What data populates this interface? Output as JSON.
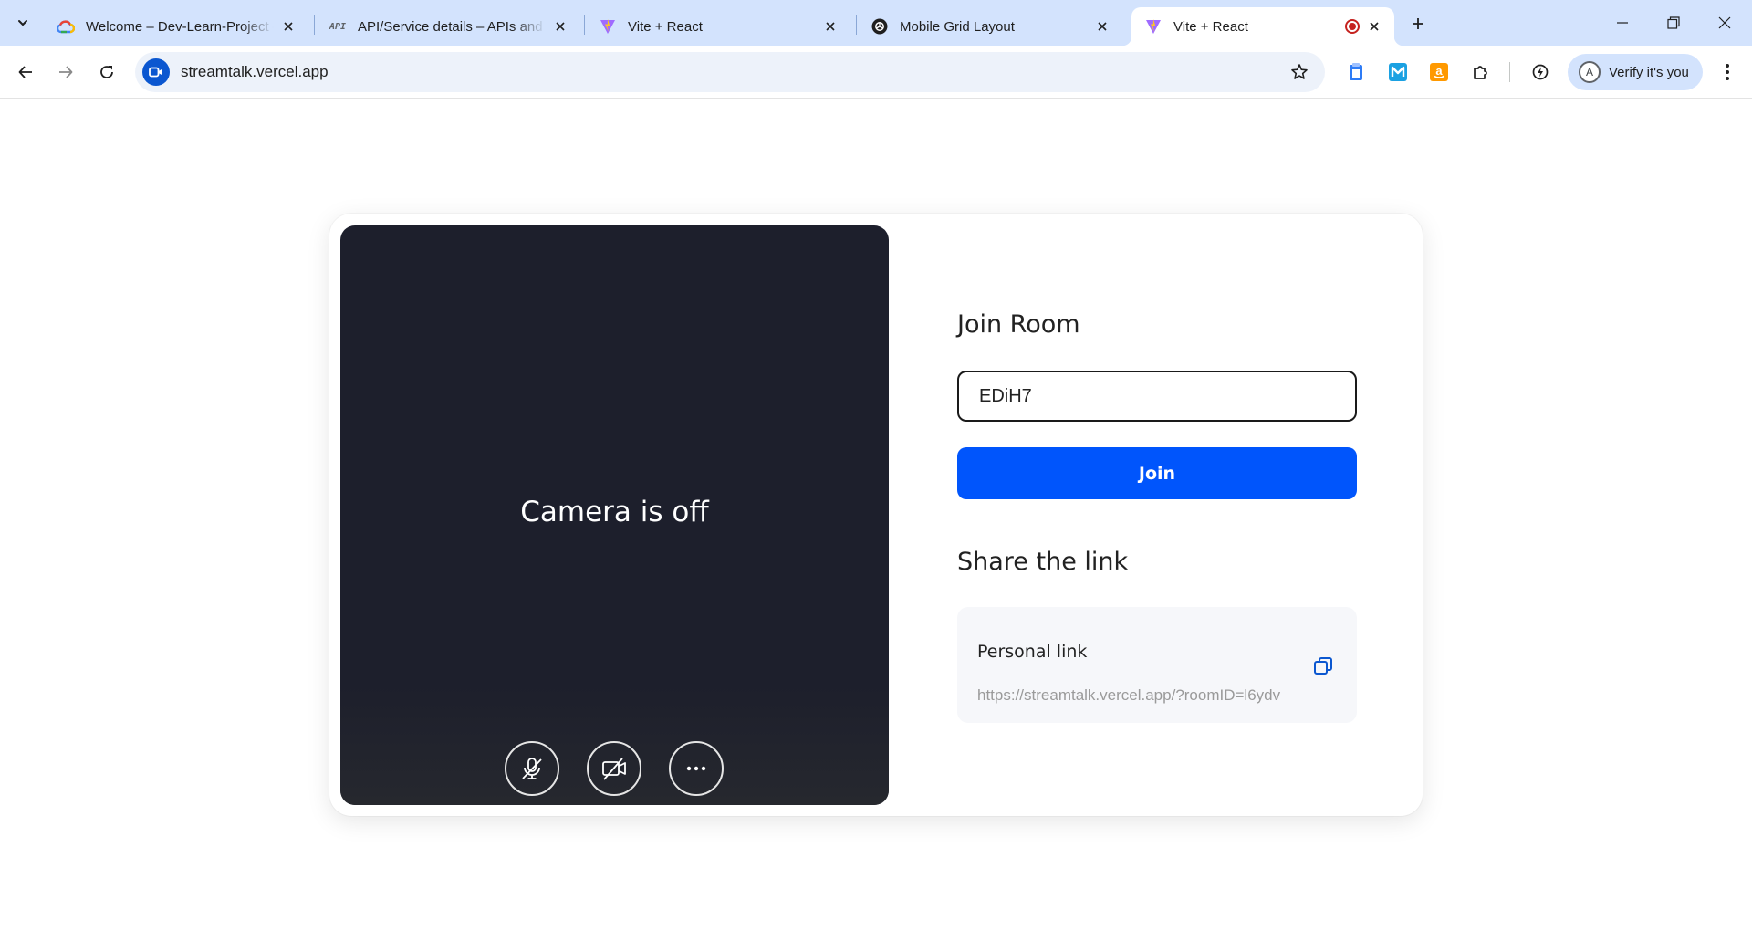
{
  "browser": {
    "tabs": [
      {
        "title": "Welcome – Dev-Learn-Project –",
        "icon": "google-cloud-icon"
      },
      {
        "title": "API/Service details – APIs and se",
        "icon": "api-icon",
        "icon_text": "API"
      },
      {
        "title": "Vite + React",
        "icon": "vite-icon"
      },
      {
        "title": "Mobile Grid Layout",
        "icon": "openai-icon"
      },
      {
        "title": "Vite + React",
        "icon": "vite-icon",
        "active": true,
        "recording": true
      }
    ],
    "address": {
      "url": "streamtalk.vercel.app"
    },
    "profile": {
      "initial": "A",
      "label": "Verify it's you"
    }
  },
  "video": {
    "status_text": "Camera is off",
    "controls": [
      "mic-off-icon",
      "camera-off-icon",
      "more-options-icon"
    ]
  },
  "join": {
    "heading": "Join Room",
    "room_id_value": "EDiH7",
    "button_label": "Join"
  },
  "share": {
    "heading": "Share the link",
    "label": "Personal link",
    "url": "https://streamtalk.vercel.app/?roomID=l6ydv"
  },
  "colors": {
    "tabstrip_bg": "#d3e3fd",
    "join_button": "#0055fc",
    "video_bg": "#1d1f2c",
    "copy_icon": "#0b57d0"
  }
}
